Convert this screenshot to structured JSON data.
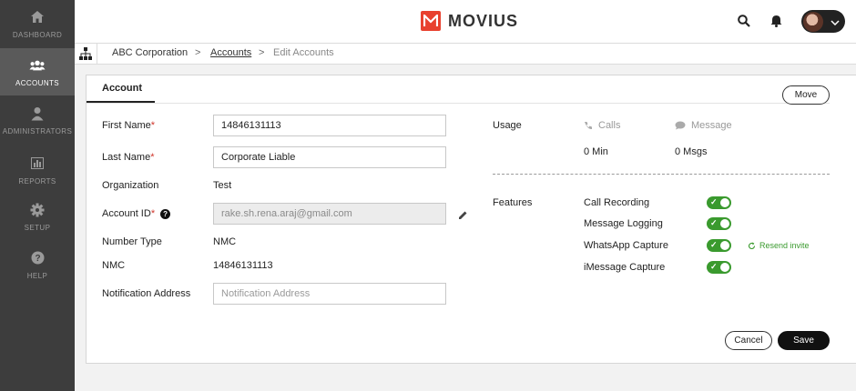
{
  "sidebar": {
    "items": [
      {
        "label": "DASHBOARD",
        "icon": "home-icon",
        "active": false
      },
      {
        "label": "ACCOUNTS",
        "icon": "users-icon",
        "active": true
      },
      {
        "label": "ADMINISTRATORS",
        "icon": "admin-icon",
        "active": false
      },
      {
        "label": "REPORTS",
        "icon": "chart-icon",
        "active": false
      },
      {
        "label": "SETUP",
        "icon": "gear-icon",
        "active": false
      },
      {
        "label": "HELP",
        "icon": "question-icon",
        "active": false
      }
    ]
  },
  "header": {
    "brand": "MOVIUS",
    "brand_color": "#e8412f",
    "icons": [
      "search-icon",
      "bell-icon",
      "avatar",
      "chevron-down-icon"
    ]
  },
  "breadcrumb": {
    "org": "ABC Corporation",
    "accounts": "Accounts",
    "current": "Edit Accounts",
    "separator": ">"
  },
  "card": {
    "tab": "Account",
    "move": "Move"
  },
  "form": {
    "first_name": {
      "label": "First Name",
      "required": "*",
      "value": "14846131113"
    },
    "last_name": {
      "label": "Last Name",
      "required": "*",
      "value": "Corporate Liable"
    },
    "organization": {
      "label": "Organization",
      "value": "Test"
    },
    "account_id": {
      "label": "Account ID",
      "required": "*",
      "help": "?",
      "value": "rake.sh.rena.araj@gmail.com"
    },
    "number_type": {
      "label": "Number Type",
      "value": "NMC"
    },
    "nmc": {
      "label": "NMC",
      "value": "14846131113"
    },
    "notification_address": {
      "label": "Notification Address",
      "value": "",
      "placeholder": "Notification Address"
    }
  },
  "usage": {
    "label": "Usage",
    "calls_header": "Calls",
    "message_header": "Message",
    "calls_value": "0 Min",
    "message_value": "0 Msgs"
  },
  "features": {
    "label": "Features",
    "items": [
      {
        "name": "Call Recording",
        "enabled": true
      },
      {
        "name": "Message Logging",
        "enabled": true
      },
      {
        "name": "WhatsApp Capture",
        "enabled": true
      },
      {
        "name": "iMessage Capture",
        "enabled": true
      }
    ],
    "resend": "Resend invite",
    "toggle_color": "#3a9a2e"
  },
  "actions": {
    "cancel": "Cancel",
    "save": "Save"
  }
}
